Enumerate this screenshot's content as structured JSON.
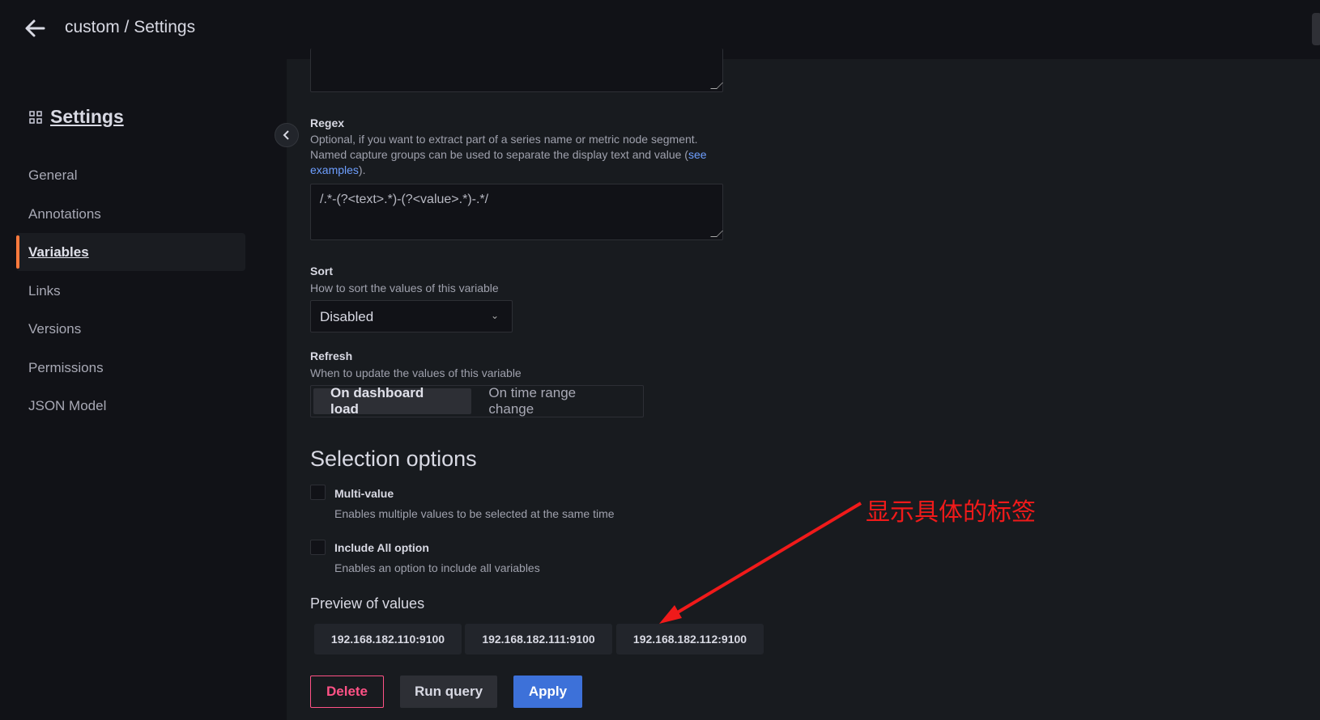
{
  "header": {
    "title": "custom / Settings"
  },
  "sidebar": {
    "heading": "Settings",
    "items": [
      {
        "label": "General"
      },
      {
        "label": "Annotations"
      },
      {
        "label": "Variables",
        "active": true
      },
      {
        "label": "Links"
      },
      {
        "label": "Versions"
      },
      {
        "label": "Permissions"
      },
      {
        "label": "JSON Model"
      }
    ]
  },
  "form": {
    "regex": {
      "label": "Regex",
      "desc1": "Optional, if you want to extract part of a series name or metric node segment.",
      "desc2": "Named capture groups can be used to separate the display text and value (",
      "link_part1": "see",
      "link_part2": "examples",
      "desc_end": ").",
      "value": "/.*-(?<text>.*)-(?<value>.*)-.*/"
    },
    "sort": {
      "label": "Sort",
      "desc": "How to sort the values of this variable",
      "value": "Disabled"
    },
    "refresh": {
      "label": "Refresh",
      "desc": "When to update the values of this variable",
      "options": [
        "On dashboard load",
        "On time range change"
      ],
      "selected": "On dashboard load"
    },
    "selection": {
      "heading": "Selection options",
      "multi": {
        "label": "Multi-value",
        "desc": "Enables multiple values to be selected at the same time",
        "checked": false
      },
      "includeAll": {
        "label": "Include All option",
        "desc": "Enables an option to include all variables",
        "checked": false
      }
    },
    "preview": {
      "heading": "Preview of values",
      "values": [
        "192.168.182.110:9100",
        "192.168.182.111:9100",
        "192.168.182.112:9100"
      ]
    },
    "buttons": {
      "delete": "Delete",
      "run": "Run query",
      "apply": "Apply"
    }
  },
  "annotation": {
    "text": "显示具体的标签",
    "color": "#f01a1a"
  },
  "colors": {
    "accent": "#ff7a3d",
    "primary": "#3d71d9",
    "danger": "#ff5286"
  }
}
